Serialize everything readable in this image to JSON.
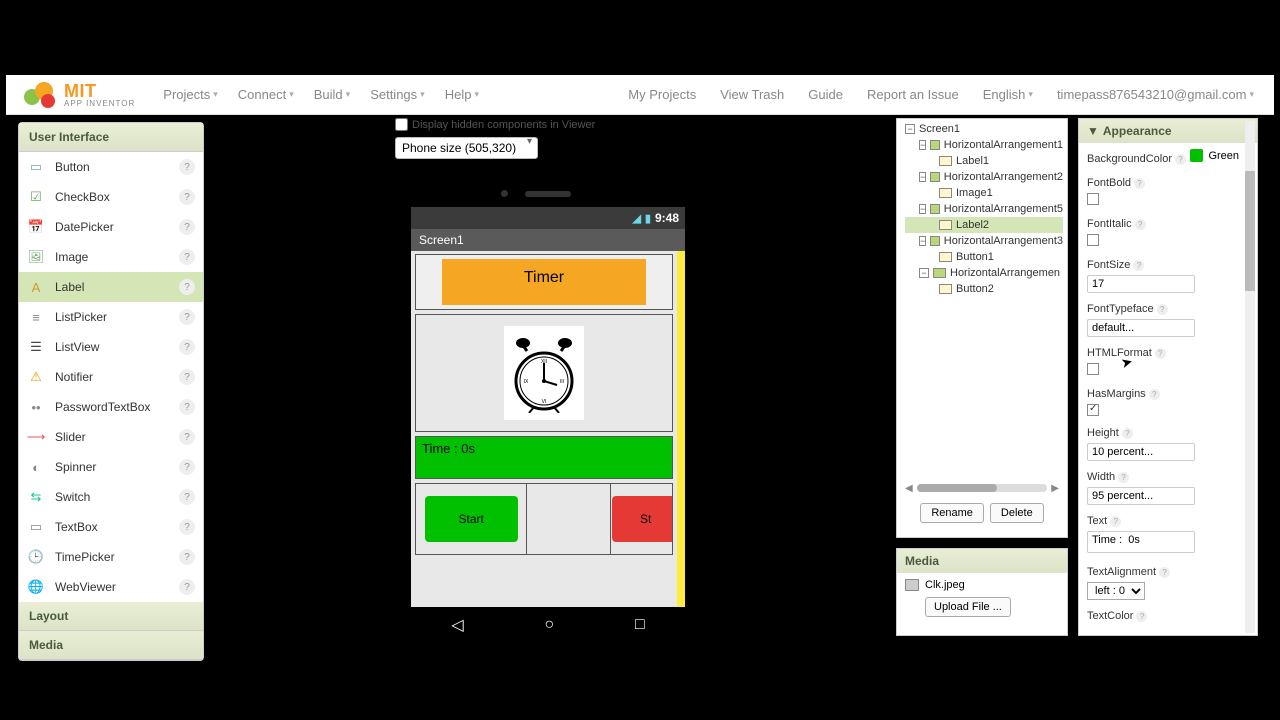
{
  "logo": {
    "brand": "MIT",
    "sub": "APP INVENTOR"
  },
  "menus_left": [
    "Projects",
    "Connect",
    "Build",
    "Settings",
    "Help"
  ],
  "menus_right": [
    "My Projects",
    "View Trash",
    "Guide",
    "Report an Issue",
    "English"
  ],
  "account_email": "timepass876543210@gmail.com",
  "palette": {
    "category_open": "User Interface",
    "items": [
      {
        "label": "Button",
        "icon": "button-icon"
      },
      {
        "label": "CheckBox",
        "icon": "checkbox-icon"
      },
      {
        "label": "DatePicker",
        "icon": "datepicker-icon"
      },
      {
        "label": "Image",
        "icon": "image-icon"
      },
      {
        "label": "Label",
        "icon": "label-icon",
        "selected": true
      },
      {
        "label": "ListPicker",
        "icon": "listpicker-icon"
      },
      {
        "label": "ListView",
        "icon": "listview-icon"
      },
      {
        "label": "Notifier",
        "icon": "notifier-icon"
      },
      {
        "label": "PasswordTextBox",
        "icon": "password-icon"
      },
      {
        "label": "Slider",
        "icon": "slider-icon"
      },
      {
        "label": "Spinner",
        "icon": "spinner-icon"
      },
      {
        "label": "Switch",
        "icon": "switch-icon"
      },
      {
        "label": "TextBox",
        "icon": "textbox-icon"
      },
      {
        "label": "TimePicker",
        "icon": "timepicker-icon"
      },
      {
        "label": "WebViewer",
        "icon": "webviewer-icon"
      }
    ],
    "categories_collapsed": [
      "Layout",
      "Media"
    ]
  },
  "viewer": {
    "hidden_checkbox_label": "Display hidden components in Viewer",
    "phone_size_label": "Phone size (505,320)",
    "status_time": "9:48",
    "screen_title": "Screen1",
    "timer_label": "Timer",
    "time_text": "Time : 0s",
    "start_btn": "Start",
    "stop_btn": "St"
  },
  "components": {
    "root": "Screen1",
    "tree": [
      {
        "name": "HorizontalArrangement1",
        "children": [
          "Label1"
        ]
      },
      {
        "name": "HorizontalArrangement2",
        "children": [
          "Image1"
        ]
      },
      {
        "name": "HorizontalArrangement5",
        "children": [
          "Label2"
        ],
        "selected_child": "Label2"
      },
      {
        "name": "HorizontalArrangement3",
        "children": [
          "Button1"
        ]
      },
      {
        "name": "HorizontalArrangemen",
        "children": [
          "Button2"
        ]
      }
    ],
    "rename_btn": "Rename",
    "delete_btn": "Delete"
  },
  "media": {
    "header": "Media",
    "file": "Clk.jpeg",
    "upload_btn": "Upload File ..."
  },
  "properties": {
    "section": "Appearance",
    "rows": {
      "BackgroundColor": {
        "label": "BackgroundColor",
        "value": "Green",
        "swatch": "#00c000"
      },
      "FontBold": {
        "label": "FontBold",
        "checked": false
      },
      "FontItalic": {
        "label": "FontItalic",
        "checked": false
      },
      "FontSize": {
        "label": "FontSize",
        "value": "17"
      },
      "FontTypeface": {
        "label": "FontTypeface",
        "value": "default..."
      },
      "HTMLFormat": {
        "label": "HTMLFormat",
        "checked": false
      },
      "HasMargins": {
        "label": "HasMargins",
        "checked": true
      },
      "Height": {
        "label": "Height",
        "value": "10 percent..."
      },
      "Width": {
        "label": "Width",
        "value": "95 percent..."
      },
      "Text": {
        "label": "Text",
        "value": "Time :  0s"
      },
      "TextAlignment": {
        "label": "TextAlignment",
        "value": "left : 0"
      },
      "TextColor": {
        "label": "TextColor"
      }
    }
  }
}
